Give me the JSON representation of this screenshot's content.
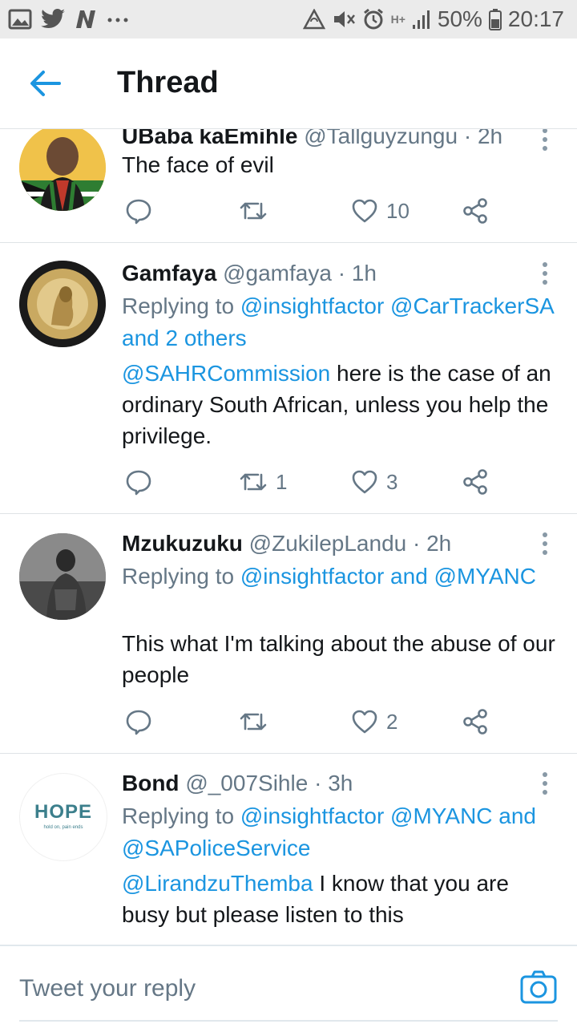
{
  "status_bar": {
    "battery": "50%",
    "time": "20:17",
    "network": "H+",
    "left_icons": [
      "gallery-icon",
      "twitter-icon",
      "n-app-icon",
      "more-dots-icon"
    ],
    "right_icons": [
      "sync-icon",
      "mute-icon",
      "alarm-icon",
      "signal-icon",
      "battery-icon"
    ]
  },
  "header": {
    "title": "Thread"
  },
  "tweets": [
    {
      "name": "UBaba kaEmihle",
      "handle": "@Tallguyzungu",
      "time": "2h",
      "text": "The face of evil",
      "replies": "",
      "retweets": "",
      "likes": "10"
    },
    {
      "name": "Gamfaya",
      "handle": "@gamfaya",
      "time": "1h",
      "reply_prefix": "Replying to",
      "reply_to": "@insightfactor @CarTrackerSA and 2 others",
      "mention": "@SAHRCommission",
      "text": "here is the case of an ordinary South African, unless you help the privilege.",
      "replies": "",
      "retweets": "1",
      "likes": "3"
    },
    {
      "name": "Mzukuzuku",
      "handle": "@ZukilepLandu",
      "time": "2h",
      "reply_prefix": "Replying to",
      "reply_to": "@insightfactor and @MYANC",
      "text": "This what I'm talking about the abuse of our people",
      "replies": "",
      "retweets": "",
      "likes": "2"
    },
    {
      "name": "Bond",
      "handle": "@_007Sihle",
      "time": "3h",
      "reply_prefix": "Replying to",
      "reply_to": "@insightfactor @MYANC and @SAPoliceService",
      "mention": "@LirandzuThemba",
      "text": "I know that you are busy but please listen to this",
      "avatar_text": "HOPE",
      "avatar_subtext": "hold on, pain ends"
    }
  ],
  "reply_bar": {
    "placeholder": "Tweet your reply"
  },
  "colors": {
    "accent": "#1b95e0",
    "text": "#14171a",
    "secondary": "#657786",
    "divider": "#dfe3e6"
  }
}
